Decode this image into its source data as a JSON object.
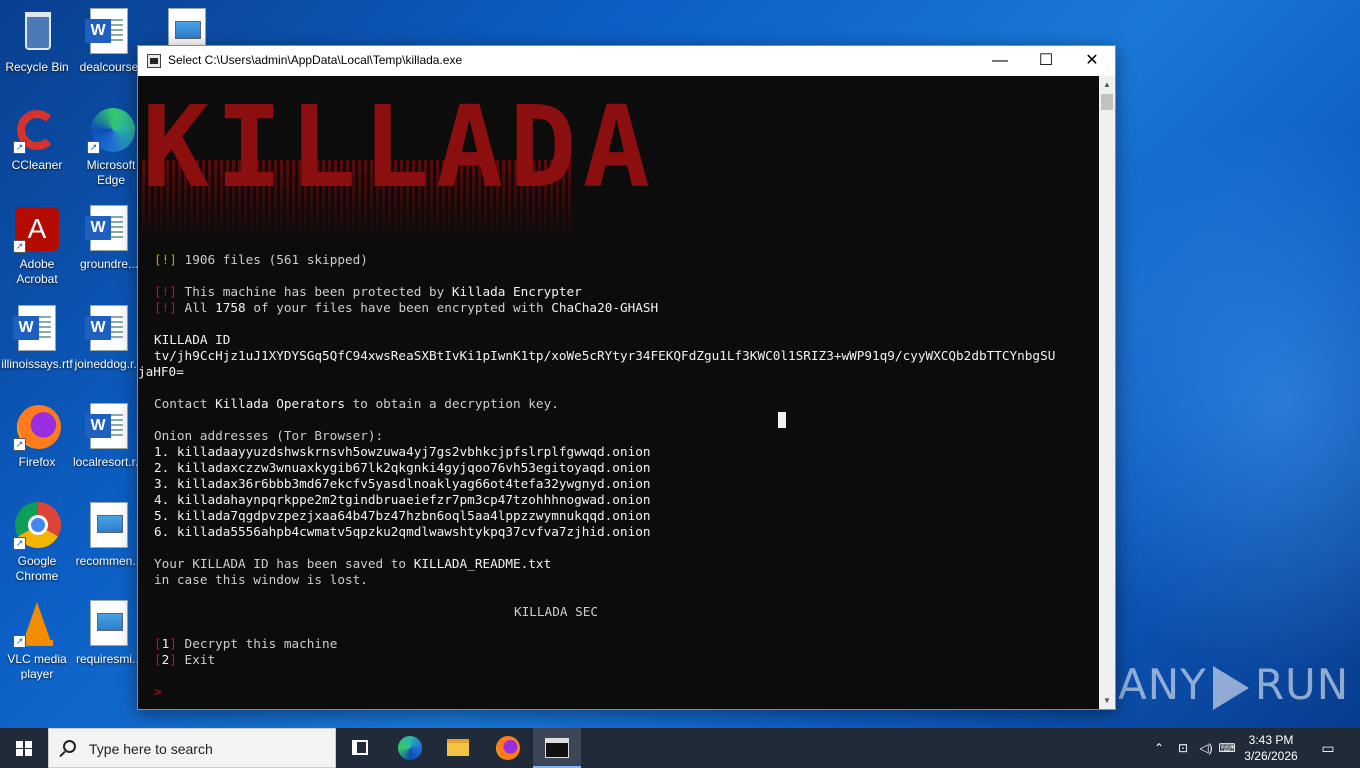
{
  "desktop": {
    "icons": [
      {
        "label": "Recycle Bin",
        "icon": "recycle-bin-icon"
      },
      {
        "label": "dealcourse",
        "icon": "word-doc-icon"
      },
      {
        "label": "",
        "icon": "image-doc-icon"
      },
      {
        "label": "CCleaner",
        "icon": "ccleaner-icon"
      },
      {
        "label": "Microsoft Edge",
        "icon": "edge-icon"
      },
      {
        "label": "Adobe Acrobat",
        "icon": "acrobat-icon"
      },
      {
        "label": "groundre...",
        "icon": "word-doc-icon"
      },
      {
        "label": "illinoissays.rtf",
        "icon": "word-doc-icon"
      },
      {
        "label": "joineddog.r...",
        "icon": "word-doc-icon"
      },
      {
        "label": "Firefox",
        "icon": "firefox-icon"
      },
      {
        "label": "localresort.r...",
        "icon": "word-doc-icon"
      },
      {
        "label": "Google Chrome",
        "icon": "chrome-icon"
      },
      {
        "label": "recommen...",
        "icon": "image-doc-icon"
      },
      {
        "label": "VLC media player",
        "icon": "vlc-icon"
      },
      {
        "label": "requiresmi...",
        "icon": "image-doc-icon"
      }
    ]
  },
  "window": {
    "title": "Select C:\\Users\\admin\\AppData\\Local\\Temp\\killada.exe",
    "minimize": "—",
    "maximize": "☐",
    "close": "✕"
  },
  "console": {
    "banner": "KILLADA",
    "status_mark": "[!]",
    "status_text": " 1906 files (561 skipped)",
    "warn1_mark": "[!]",
    "warn1_pre": " This machine has been protected by ",
    "warn1_strong": "Killada Encrypter",
    "warn2_mark": "[!]",
    "warn2_pre": " All ",
    "warn2_count": "1758",
    "warn2_mid": " of your files have been encrypted with ",
    "warn2_algo": "ChaCha20-GHASH",
    "id_label": "KILLADA ID",
    "id_line1": "tv/jh9CcHjz1uJ1XYDYSGq5QfC94xwsReaSXBtIvKi1pIwnK1tp/xoWe5cRYtyr34FEKQFdZgu1Lf3KWC0l1SRIZ3+wWP91q9/cyyWXCQb2dbTTCYnbgSU",
    "id_line2": "jaHF0=",
    "contact_pre": "Contact ",
    "contact_strong": "Killada Operators",
    "contact_post": " to obtain a decryption key.",
    "onion_header": "Onion addresses (Tor Browser):",
    "onions": [
      "1. killadaayyuzdshwskrnsvh5owzuwa4yj7gs2vbhkcjpfslrplfgwwqd.onion",
      "2. killadaxczzw3wnuaxkygib67lk2qkgnki4gyjqoo76vh53egitoyaqd.onion",
      "3. killadax36r6bbb3md67ekcfv5yasdlnoaklyag66ot4tefa32ywgnyd.onion",
      "4. killadahaynpqrkppe2m2tgindbruaeiefzr7pm3cp47tzohhhnogwad.onion",
      "5. killada7qgdpvzpezjxaa64b47bz47hzbn6oql5aa4lppzzwymnukqqd.onion",
      "6. killada5556ahpb4cwmatv5qpzku2qmdlwawshtykpq37cvfva7zjhid.onion"
    ],
    "saved_pre": "Your KILLADA ID has been saved to ",
    "saved_file": "KILLADA_README.txt",
    "saved_line2": "in case this window is lost.",
    "footer": "KILLADA SEC",
    "opt1_open": "[",
    "opt1_num": "1",
    "opt1_close": "]",
    "opt1_label": " Decrypt this machine",
    "opt2_open": "[",
    "opt2_num": "2",
    "opt2_close": "]",
    "opt2_label": " Exit",
    "prompt": ">"
  },
  "taskbar": {
    "search_placeholder": "Type here to search",
    "clock_time": "3:43 PM",
    "clock_date": "3/26/2026"
  },
  "watermark": {
    "left": "ANY",
    "right": "RUN"
  },
  "colors": {
    "console_bg": "#0c0c0c",
    "console_red": "#c50f1f",
    "console_yellow": "#c19c00",
    "banner_red": "#8b0f0f"
  }
}
